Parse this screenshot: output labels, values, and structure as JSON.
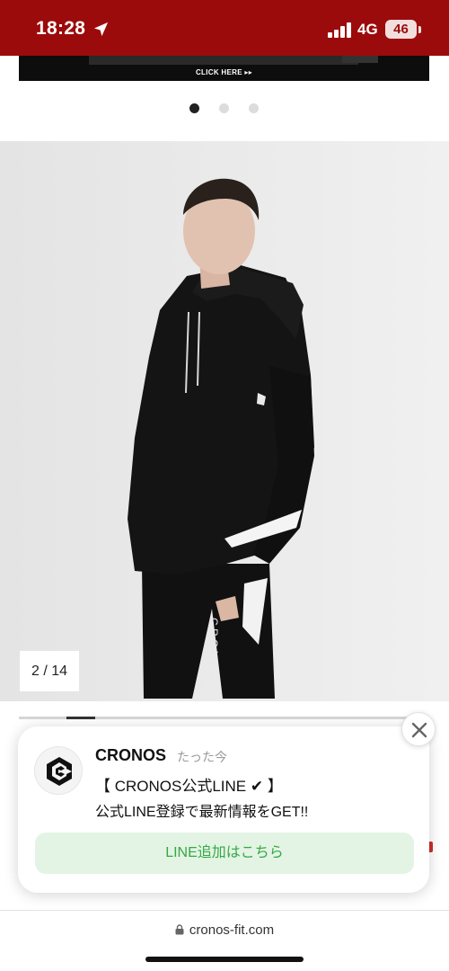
{
  "status_bar": {
    "time": "18:28",
    "network": "4G",
    "battery": "46",
    "background_color": "#9c0b0b",
    "icons": [
      "location-arrow-icon",
      "signal-bars-icon",
      "battery-icon"
    ]
  },
  "banner": {
    "cta": "CLICK HERE ▸▸"
  },
  "carousel": {
    "dot_count": 3,
    "active_dot": 1
  },
  "gallery": {
    "counter": "2 / 14",
    "progress_fraction": 0.14
  },
  "notification": {
    "sender": "CRONOS",
    "time": "たった今",
    "title": "【 CRONOS公式LINE ✔ 】",
    "body": "公式LINE登録で最新情報をGET!!",
    "action_label": "LINE追加はこちら",
    "action_color": "#35a845",
    "icons": [
      "cronos-logo-icon",
      "close-icon"
    ]
  },
  "browser": {
    "url": "cronos-fit.com"
  }
}
